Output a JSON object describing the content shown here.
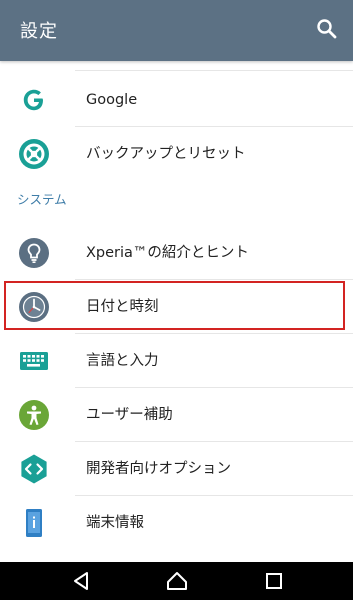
{
  "appbar": {
    "title": "設定",
    "search_icon": "search-icon"
  },
  "list": {
    "items_top": [
      {
        "label": "Google",
        "icon": "google-icon",
        "color": "#1aa096"
      },
      {
        "label": "バックアップとリセット",
        "icon": "backup-reset-icon",
        "color": "#1aa096"
      }
    ],
    "section_header": "システム",
    "items_system": [
      {
        "label": "Xperia™の紹介とヒント",
        "icon": "lightbulb-icon",
        "color": "#5b6f82"
      },
      {
        "label": "日付と時刻",
        "icon": "clock-icon",
        "color": "#5b6f82"
      },
      {
        "label": "言語と入力",
        "icon": "keyboard-icon",
        "color": "#1aa096"
      },
      {
        "label": "ユーザー補助",
        "icon": "accessibility-icon",
        "color": "#6aa637"
      },
      {
        "label": "開発者向けオプション",
        "icon": "developer-options-icon",
        "color": "#1aa096"
      },
      {
        "label": "端末情報",
        "icon": "device-info-icon",
        "color": "#2f7fc4"
      }
    ]
  },
  "navbar": {
    "back_icon": "back-icon",
    "home_icon": "home-icon",
    "recents_icon": "recents-icon"
  },
  "colors": {
    "appbar": "#5c7184",
    "accent": "#3f7da8",
    "highlight": "#d32422"
  }
}
